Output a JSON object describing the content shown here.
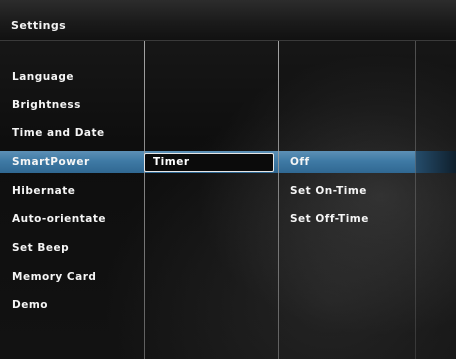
{
  "header": {
    "title": "Settings"
  },
  "menu": {
    "items": [
      {
        "label": "Language"
      },
      {
        "label": "Brightness"
      },
      {
        "label": "Time and Date"
      },
      {
        "label": "SmartPower"
      },
      {
        "label": "Hibernate"
      },
      {
        "label": "Auto-orientate"
      },
      {
        "label": "Set Beep"
      },
      {
        "label": "Memory Card"
      },
      {
        "label": "Demo"
      }
    ],
    "selected": "SmartPower"
  },
  "submenu": {
    "selected_label": "Timer"
  },
  "options": {
    "items": [
      {
        "label": "Off"
      },
      {
        "label": "Set On-Time"
      },
      {
        "label": "Set Off-Time"
      }
    ],
    "selected": "Off"
  },
  "colors": {
    "highlight": "#3f7aa5",
    "background": "#121212",
    "text": "#f5f5f5"
  }
}
